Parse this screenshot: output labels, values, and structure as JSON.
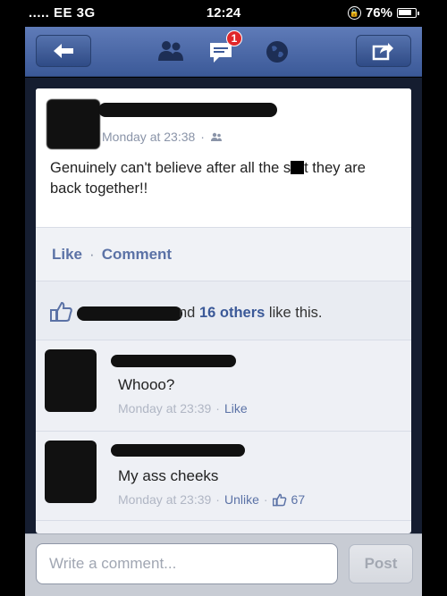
{
  "status_bar": {
    "carrier": "..... EE  3G",
    "time": "12:24",
    "battery": "76%"
  },
  "nav": {
    "notification_count": "1",
    "icons": [
      "back-arrow-icon",
      "friends-icon",
      "messages-icon",
      "globe-icon",
      "share-icon"
    ]
  },
  "post": {
    "timestamp": "Monday at 23:38",
    "separator": "·",
    "text_before": "Genuinely can't believe after all the s",
    "text_after": "t they are back together!!"
  },
  "actions": {
    "like": "Like",
    "separator": "·",
    "comment": "Comment"
  },
  "likes": {
    "prefix": "nd ",
    "others": "16 others",
    "suffix": " like this."
  },
  "comments": [
    {
      "text": "Whooo?",
      "time": "Monday at 23:39",
      "separator": "·",
      "action": "Like"
    },
    {
      "text": "My ass cheeks",
      "time": "Monday at 23:39",
      "separator": "·",
      "action": "Unlike",
      "separator2": "·",
      "like_count": "67"
    }
  ],
  "compose": {
    "placeholder": "Write a comment...",
    "post_label": "Post"
  },
  "colors": {
    "nav": "#3b5998",
    "link": "#5b72a6",
    "badge": "#e0262a"
  }
}
